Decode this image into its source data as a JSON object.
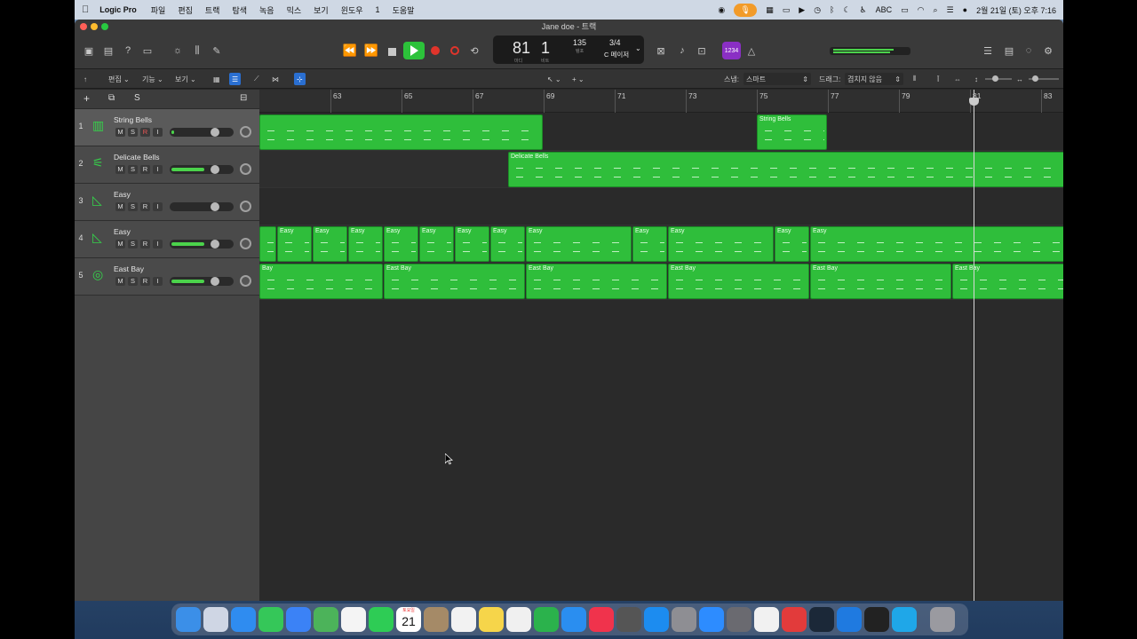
{
  "menubar": {
    "app": "Logic Pro",
    "items": [
      "파일",
      "편집",
      "트랙",
      "탐색",
      "녹음",
      "믹스",
      "보기",
      "윈도우",
      "1",
      "도움말"
    ],
    "input_indicator": "ABC",
    "datetime": "2월 21일 (토) 오후 7:16"
  },
  "window": {
    "title": "Jane doe - 트랙"
  },
  "transport": {
    "bar": "81",
    "beat": "1",
    "bar_label": "마디",
    "beat_label": "비트",
    "tempo": "135",
    "tempo_label": "템포",
    "time_signature": "3/4",
    "key": "C 메이저",
    "count_in": "1234"
  },
  "toolbar": {
    "edit_menu": "편집",
    "function_menu": "기능",
    "view_menu": "보기",
    "snap_label": "스냅:",
    "snap_value": "스마트",
    "drag_label": "드래그:",
    "drag_value": "겹치지 않음"
  },
  "header_tools": {
    "add_label": "+",
    "s_label": "S"
  },
  "ruler": {
    "bars": [
      "63",
      "65",
      "67",
      "69",
      "71",
      "73",
      "75",
      "77",
      "79",
      "81",
      "83"
    ]
  },
  "tracks": [
    {
      "num": "1",
      "name": "String Bells",
      "m": "M",
      "s": "S",
      "r": "R",
      "i": "I",
      "volume": 0.05,
      "selected": true,
      "icon": "piano-roll-icon"
    },
    {
      "num": "2",
      "name": "Delicate Bells",
      "m": "M",
      "s": "S",
      "r": "R",
      "i": "I",
      "volume": 0.72,
      "selected": false,
      "icon": "xylophone-icon"
    },
    {
      "num": "3",
      "name": "Easy",
      "m": "M",
      "s": "S",
      "r": "R",
      "i": "I",
      "volume": 0.0,
      "selected": false,
      "icon": "grand-piano-icon"
    },
    {
      "num": "4",
      "name": "Easy",
      "m": "M",
      "s": "S",
      "r": "R",
      "i": "I",
      "volume": 0.72,
      "selected": false,
      "icon": "grand-piano-icon"
    },
    {
      "num": "5",
      "name": "East Bay",
      "m": "M",
      "s": "S",
      "r": "R",
      "i": "I",
      "volume": 0.72,
      "selected": false,
      "icon": "drum-kit-icon"
    }
  ],
  "regions": {
    "track1": [
      {
        "name": "",
        "start_bar": 61.0,
        "end_bar": 69.0
      },
      {
        "name": "String Bells",
        "start_bar": 75.0,
        "end_bar": 77.0
      },
      {
        "name": "",
        "start_bar": 83.9,
        "end_bar": 85.0
      }
    ],
    "track2": [
      {
        "name": "Delicate Bells",
        "start_bar": 68.0,
        "end_bar": 83.9
      },
      {
        "name": "",
        "start_bar": 83.9,
        "end_bar": 85.0
      }
    ],
    "track4": [
      {
        "name": "",
        "start_bar": 61.0,
        "end_bar": 61.5
      },
      {
        "name": "Easy",
        "start_bar": 61.5,
        "end_bar": 62.5
      },
      {
        "name": "Easy",
        "start_bar": 62.5,
        "end_bar": 63.5
      },
      {
        "name": "Easy",
        "start_bar": 63.5,
        "end_bar": 64.5
      },
      {
        "name": "Easy",
        "start_bar": 64.5,
        "end_bar": 65.5
      },
      {
        "name": "Easy",
        "start_bar": 65.5,
        "end_bar": 66.5
      },
      {
        "name": "Easy",
        "start_bar": 66.5,
        "end_bar": 67.5
      },
      {
        "name": "Easy",
        "start_bar": 67.5,
        "end_bar": 68.5
      },
      {
        "name": "Easy",
        "start_bar": 68.5,
        "end_bar": 71.5
      },
      {
        "name": "Easy",
        "start_bar": 71.5,
        "end_bar": 72.5
      },
      {
        "name": "Easy",
        "start_bar": 72.5,
        "end_bar": 75.5
      },
      {
        "name": "Easy",
        "start_bar": 75.5,
        "end_bar": 76.5
      },
      {
        "name": "Easy",
        "start_bar": 76.5,
        "end_bar": 83.9
      },
      {
        "name": "",
        "start_bar": 83.9,
        "end_bar": 85.0
      }
    ],
    "track5": [
      {
        "name": "Bay",
        "start_bar": 61.0,
        "end_bar": 64.5
      },
      {
        "name": "East Bay",
        "start_bar": 64.5,
        "end_bar": 68.5
      },
      {
        "name": "East Bay",
        "start_bar": 68.5,
        "end_bar": 72.5
      },
      {
        "name": "East Bay",
        "start_bar": 72.5,
        "end_bar": 76.5
      },
      {
        "name": "East Bay",
        "start_bar": 76.5,
        "end_bar": 80.5
      },
      {
        "name": "East Bay",
        "start_bar": 80.5,
        "end_bar": 84.0
      }
    ]
  },
  "playhead_bar": 81.1,
  "colors": {
    "region": "#2fbe3b",
    "accent": "#2a6fd1",
    "record": "#e0342b",
    "play": "#2cc23a"
  },
  "dock_icons": [
    "finder-icon",
    "launchpad-icon",
    "safari-icon",
    "messages-icon",
    "mail-icon",
    "maps-icon",
    "photos-icon",
    "facetime-icon",
    "calendar-icon",
    "contacts-icon",
    "reminders-icon",
    "notes-icon",
    "freeform-icon",
    "numbers-icon",
    "keynote-icon",
    "music-icon",
    "screenshot-icon",
    "appstore-icon",
    "settings-icon",
    "zoom-icon",
    "iphone-mirror-icon",
    "infuse-icon",
    "parallels-icon",
    "steam-icon",
    "windows-app-icon",
    "logic-pro-icon",
    "quick-icon",
    "trash-icon"
  ],
  "dock_calendar": {
    "month": "토요일",
    "day": "21"
  }
}
